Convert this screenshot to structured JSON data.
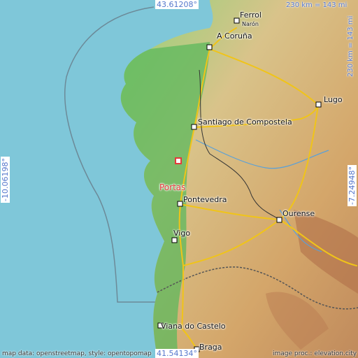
{
  "colors": {
    "sea": "#7fc7d9",
    "lowland": "#5cb85c",
    "highland": "#d8b16c",
    "road": "#f0c419",
    "border": "#444444",
    "target": "#e23a3a",
    "coord_text": "#5577cc"
  },
  "cities": [
    {
      "name": "Ferrol"
    },
    {
      "name": "Narón"
    },
    {
      "name": "A Coruña"
    },
    {
      "name": "Lugo"
    },
    {
      "name": "Santiago de Compostela"
    },
    {
      "name": "Portas"
    },
    {
      "name": "Pontevedra"
    },
    {
      "name": "Ourense"
    },
    {
      "name": "Vigo"
    },
    {
      "name": "Viana do Castelo"
    },
    {
      "name": "Braga"
    }
  ],
  "coords": {
    "top": "43.61208°",
    "bottom": "41.54134°",
    "left": "-10.06198°",
    "right": "-7.24948°"
  },
  "scale": {
    "top": "230 km = 143 mi",
    "right": "230 km = 143 mi"
  },
  "footer": {
    "left": "map data: openstreetmap, style: opentopomap",
    "right": "image proc.: elevation.city"
  }
}
